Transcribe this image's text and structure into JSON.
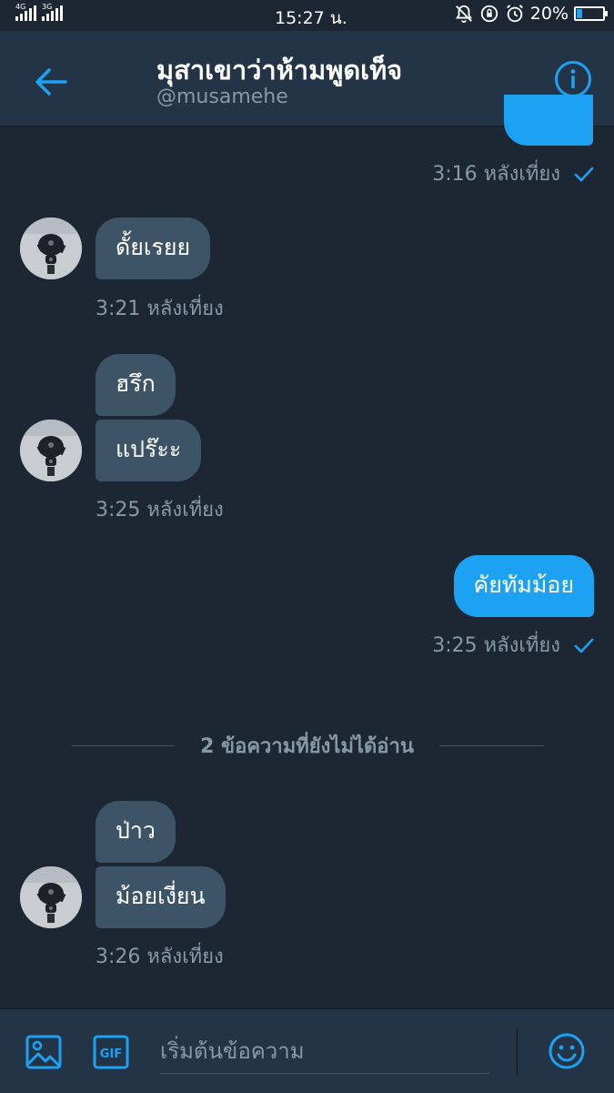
{
  "status_bar": {
    "network_1": "4G",
    "network_2": "3G",
    "time": "15:27 น.",
    "battery": "20%",
    "battery_level": 0.2
  },
  "header": {
    "title": "มุสาเขาว่าห้ามพูดเท็จ",
    "handle": "@musamehe"
  },
  "messages": {
    "m0_time": "3:16 หลังเที่ยง",
    "m1_text": "ดั้ยเรยย",
    "m1_time": "3:21 หลังเที่ยง",
    "m2_text": "ฮรึก",
    "m3_text": "แปร๊ะะ",
    "m3_time": "3:25 หลังเที่ยง",
    "m4_text": "คัยทัมม้อย",
    "m4_time": "3:25 หลังเที่ยง",
    "unread_divider": "2 ข้อความที่ยังไม่ได้อ่าน",
    "m5_text": "ป่าว",
    "m6_text": "ม้อยเงี่ยน",
    "m6_time": "3:26 หลังเที่ยง"
  },
  "composer": {
    "placeholder": "เริ่มต้นข้อความ",
    "gif_label": "GIF"
  },
  "colors": {
    "background": "#1c2733",
    "header": "#243447",
    "accent": "#1da1f2",
    "received_bubble": "#3d5466",
    "secondary_text": "#8899a6"
  },
  "icons": [
    "back-arrow-icon",
    "info-icon",
    "image-icon",
    "gif-icon",
    "emoji-icon",
    "sent-check-icon"
  ]
}
